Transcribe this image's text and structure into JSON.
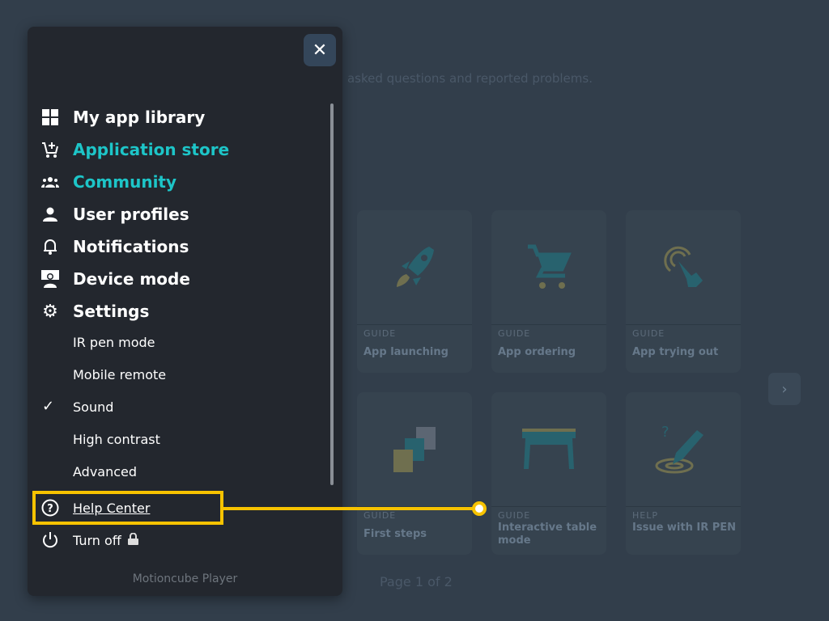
{
  "background": {
    "subtitle": "asked questions and reported problems.",
    "page_info": "Page 1 of 2",
    "cards": [
      {
        "tag": "GUIDE",
        "title": "App launching",
        "icon": "rocket-icon"
      },
      {
        "tag": "GUIDE",
        "title": "App ordering",
        "icon": "cart-icon"
      },
      {
        "tag": "GUIDE",
        "title": "App trying out",
        "icon": "touch-icon"
      },
      {
        "tag": "GUIDE",
        "title": "First steps",
        "icon": "steps-icon"
      },
      {
        "tag": "GUIDE",
        "title": "Interactive table mode",
        "icon": "table-icon"
      },
      {
        "tag": "HELP",
        "title": "Issue with IR PEN",
        "icon": "pen-icon"
      }
    ],
    "next_icon": "chevron-right-icon"
  },
  "menu": {
    "items": [
      {
        "label": "My app library",
        "icon": "grid-icon"
      },
      {
        "label": "Application store",
        "icon": "cart-plus-icon"
      },
      {
        "label": "Community",
        "icon": "group-icon"
      },
      {
        "label": "User profiles",
        "icon": "person-icon"
      },
      {
        "label": "Notifications",
        "icon": "bell-icon"
      },
      {
        "label": "Device mode",
        "icon": "device-icon"
      },
      {
        "label": "Settings",
        "icon": "gear-icon"
      }
    ],
    "settings": [
      {
        "label": "IR pen mode",
        "checked": false
      },
      {
        "label": "Mobile remote",
        "checked": false
      },
      {
        "label": "Sound",
        "checked": true
      },
      {
        "label": "High contrast",
        "checked": false
      },
      {
        "label": "Advanced",
        "checked": false
      }
    ],
    "help": "Help Center",
    "turn_off": "Turn off",
    "footer": "Motioncube Player"
  },
  "colors": {
    "accent": "#1dc5c8",
    "highlight": "#f7c300"
  }
}
